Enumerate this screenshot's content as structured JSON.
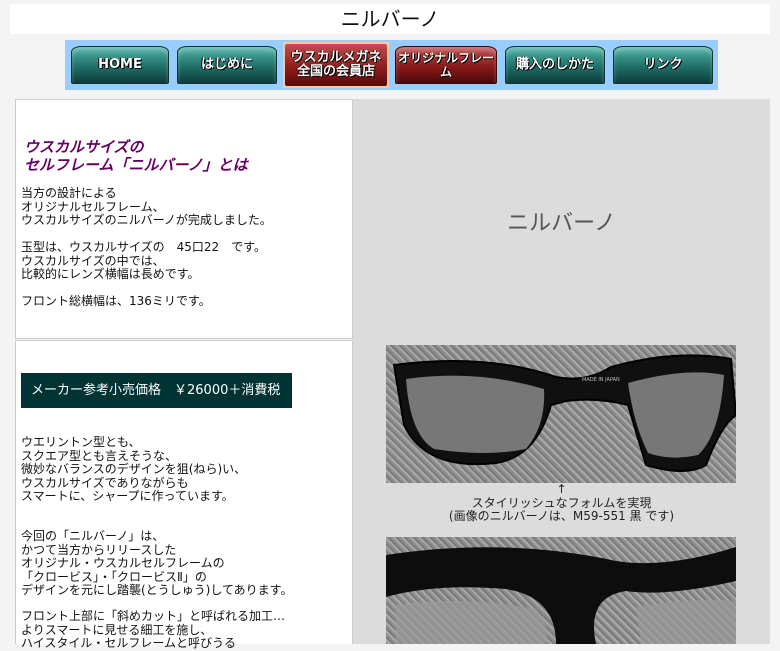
{
  "page": {
    "title": "ニルバーノ"
  },
  "nav": {
    "items": [
      {
        "label": "HOME"
      },
      {
        "label": "はじめに"
      },
      {
        "label_line1": "ウスカルメガネ",
        "label_line2": "全国の会員店"
      },
      {
        "label": "オリジナルフレーム"
      },
      {
        "label": "購入のしかた"
      },
      {
        "label": "リンク"
      }
    ]
  },
  "left_top": {
    "heading_line1": "ウスカルサイズの",
    "heading_line2": "セルフレーム「ニルバーノ」とは",
    "para1": [
      "当方の設計による",
      "オリジナルセルフレーム、",
      "ウスカルサイズのニルバーノが完成しました。"
    ],
    "para2": [
      "玉型は、ウスカルサイズの　45口22　です。",
      "ウスカルサイズの中では、",
      "比較的にレンズ横幅は長めです。"
    ],
    "para3": [
      "フロント総横幅は、136ミリです。"
    ]
  },
  "left_bottom": {
    "price": "メーカー参考小売価格　￥26000＋消費税",
    "para1": [
      "ウエリントン型とも、",
      "スクエア型とも言えそうな、",
      "微妙なバランスのデザインを狙(ねら)い、",
      "ウスカルサイズでありながらも",
      "スマートに、シャープに作っています。"
    ],
    "para2": [
      "今回の「ニルバーノ」は、",
      "かつて当方からリリースした",
      "オリジナル・ウスカルセルフレームの",
      "「クロービス」・「クロービスⅡ」の",
      "デザインを元にし踏襲(とうしゅう)してあります。"
    ],
    "para3": [
      "フロント上部に「斜めカット」と呼ばれる加工…",
      "よりスマートに見せる細工を施し、",
      "ハイスタイル・セルフレームと呼びうる"
    ]
  },
  "right": {
    "title": "ニルバーノ",
    "caption_arrow": "↑",
    "caption_line1": "スタイリッシュなフォルムを実現",
    "caption_line2": "(画像のニルバーノは、M59-551 黒 です)",
    "frame_imprint": "MADE IN JAPAN"
  },
  "colors": {
    "nav_bg": "#99ccff",
    "heading": "#660066",
    "price_banner": "#003333",
    "right_panel": "#dcdcdc"
  }
}
